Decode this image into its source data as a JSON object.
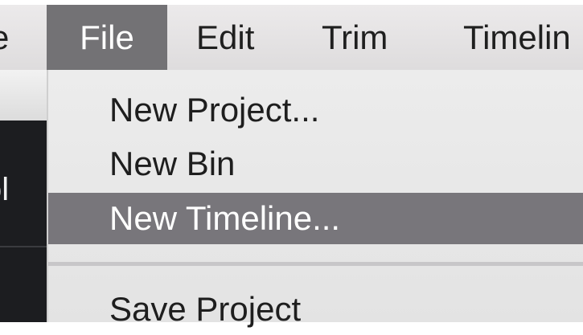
{
  "menubar": {
    "previous_menu_fragment": "e",
    "file_label": "File",
    "edit_label": "Edit",
    "trim_label": "Trim",
    "timeline_label": "Timelin"
  },
  "background_window": {
    "label_fragment": "ol"
  },
  "file_menu": {
    "items": [
      {
        "label": "New Project..."
      },
      {
        "label": "New Bin"
      },
      {
        "label": "New Timeline..."
      },
      {
        "label": "Save Project"
      }
    ],
    "highlighted_index": 2
  },
  "colors": {
    "menubar_bg": "#e4e2e3",
    "active_menu_bg": "#737275",
    "highlight_bg": "#78767b",
    "dropdown_bg": "#e8e8e8",
    "dark_panel": "#1c1d20"
  }
}
